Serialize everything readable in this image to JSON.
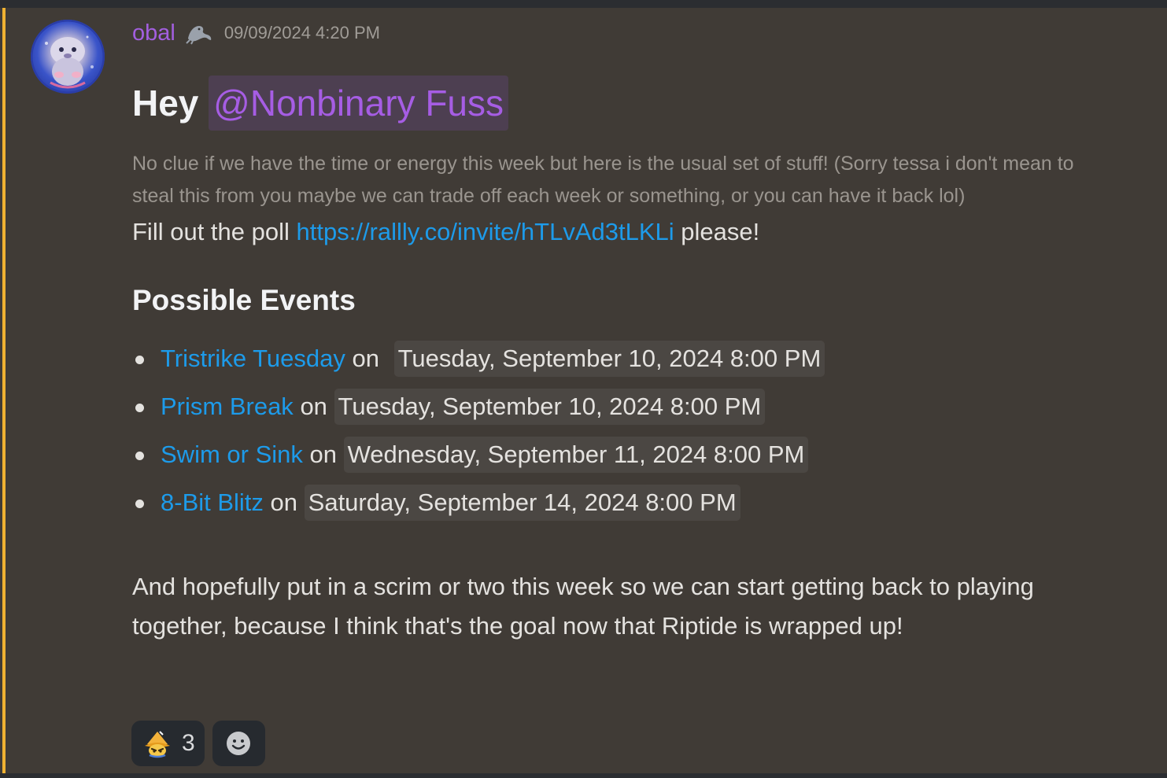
{
  "message": {
    "author": "obal",
    "role_icon": "seal-icon",
    "timestamp": "09/09/2024 4:20 PM",
    "heading_prefix": "Hey",
    "mention": "@Nonbinary Fuss",
    "subtext": "No clue if we have the time or energy this week but here is the usual set of stuff! (Sorry tessa i don't mean to steal this from you maybe we can trade off each week or something, or you can have it back lol)",
    "poll_prefix": "Fill out the poll",
    "poll_link": "https://rallly.co/invite/hTLvAd3tLKLi",
    "poll_suffix": "please!",
    "section_heading": "Possible Events",
    "events": [
      {
        "name": "Tristrike Tuesday",
        "joiner": "on",
        "date": "Tuesday, September 10, 2024 8:00 PM"
      },
      {
        "name": "Prism Break",
        "joiner": "on",
        "date": "Tuesday, September 10, 2024 8:00 PM"
      },
      {
        "name": "Swim or Sink",
        "joiner": "on",
        "date": "Wednesday, September 11, 2024 8:00 PM"
      },
      {
        "name": "8-Bit Blitz",
        "joiner": "on",
        "date": "Saturday, September 14, 2024 8:00 PM"
      }
    ],
    "closing": "And hopefully put in a scrim or two this week so we can start getting back to playing together, because I think that's the goal now that Riptide is wrapped up!"
  },
  "reactions": [
    {
      "emoji": "custom-emoji-icon",
      "count": "3"
    },
    {
      "emoji": "add-reaction-icon"
    }
  ],
  "colors": {
    "background": "#403b36",
    "username": "#a35fe0",
    "mention_text": "#a65de4",
    "mention_bg": "#4d3f51",
    "link": "#1d9bea",
    "mention_bar": "#f0b232"
  }
}
